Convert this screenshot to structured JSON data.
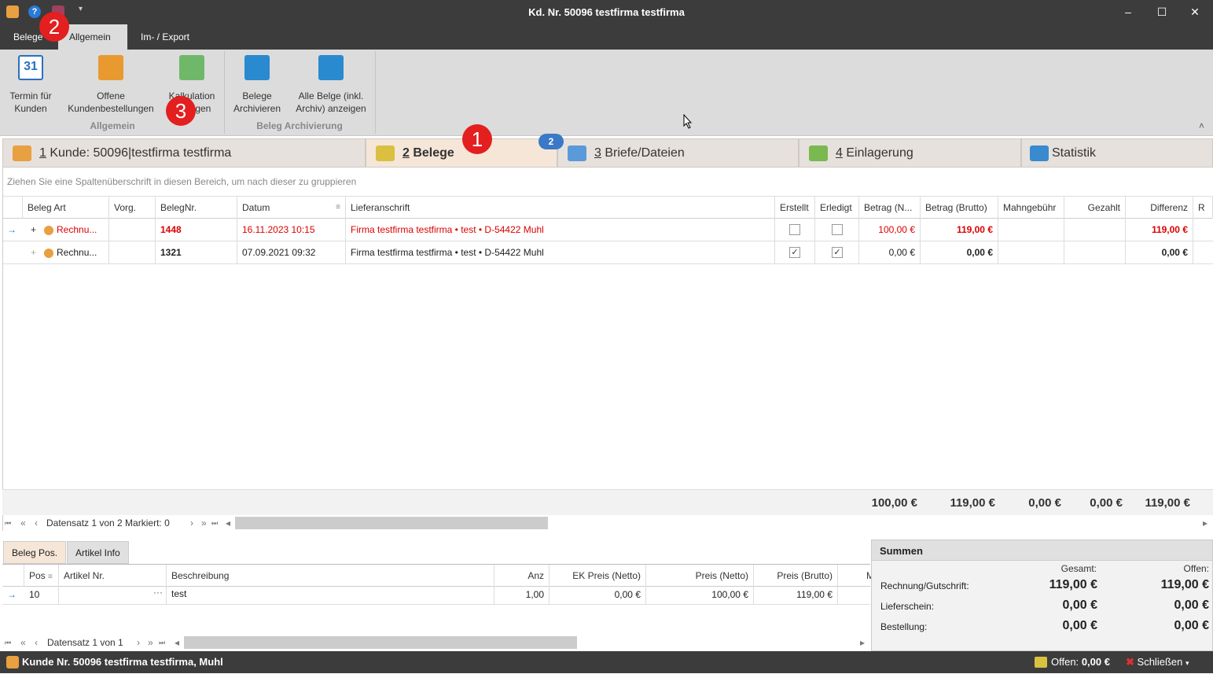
{
  "window": {
    "title": "Kd. Nr. 50096 testfirma testfirma",
    "min": "–",
    "max": "☐",
    "close": "✕",
    "qa_more": "▾"
  },
  "menu_tabs": [
    "Belege",
    "Allgemein",
    "Im- / Export"
  ],
  "ribbon": {
    "groups": [
      {
        "label": "Allgemein"
      },
      {
        "label": "Beleg Archivierung"
      }
    ],
    "buttons": [
      {
        "l1": "Termin für",
        "l2": "Kunden",
        "icon": "calendar-icon",
        "icon_text": "31"
      },
      {
        "l1": "Offene",
        "l2": "Kundenbestellungen",
        "icon": "shopping-cart-icon"
      },
      {
        "l1": "Kalkulation",
        "l2": "anzeigen",
        "icon": "calculation-icon"
      },
      {
        "l1": "Belege",
        "l2": "Archivieren",
        "icon": "archive-icon"
      },
      {
        "l1": "Alle Belge (inkl.",
        "l2": "Archiv) anzeigen",
        "icon": "archive-show-icon"
      }
    ],
    "collapse": "˄"
  },
  "annotations": [
    "1",
    "2",
    "3"
  ],
  "page_tabs": [
    {
      "num": "1",
      "label": " Kunde: 50096|testfirma testfirma"
    },
    {
      "num": "2",
      "label": " Belege"
    },
    {
      "num": "3",
      "label": " Briefe/Dateien"
    },
    {
      "num": "4",
      "label": " Einlagerung"
    },
    {
      "num": "",
      "label": "Statistik"
    }
  ],
  "tab_badge": "2",
  "group_hint": "Ziehen Sie eine Spaltenüberschrift in diesen Bereich, um nach dieser zu gruppieren",
  "columns": [
    "Beleg Art",
    "Vorg.",
    "BelegNr.",
    "Datum",
    "Lieferanschrift",
    "Erstellt",
    "Erledigt",
    "Betrag (N...",
    "Betrag (Brutto)",
    "Mahngebühr",
    "Gezahlt",
    "Differenz",
    "R"
  ],
  "rows": [
    {
      "indicator": "→",
      "expand": "+",
      "art": "Rechnu...",
      "vorg": "",
      "nr": "1448",
      "datum": "16.11.2023 10:15",
      "adresse": "Firma testfirma testfirma • test • D-54422 Muhl",
      "erstellt": "",
      "erledigt": "",
      "netto": "100,00 €",
      "brutto": "119,00 €",
      "mahn": "",
      "gezahlt": "",
      "diff": "119,00 €"
    },
    {
      "indicator": "",
      "expand": "+",
      "art": "Rechnu...",
      "vorg": "",
      "nr": "1321",
      "datum": "07.09.2021 09:32",
      "adresse": "Firma testfirma testfirma • test • D-54422 Muhl",
      "erstellt": "✓",
      "erledigt": "✓",
      "netto": "0,00 €",
      "brutto": "0,00 €",
      "mahn": "",
      "gezahlt": "",
      "diff": "0,00 €"
    }
  ],
  "totals": {
    "netto": "100,00 €",
    "brutto": "119,00 €",
    "mahn": "0,00 €",
    "gezahlt": "0,00 €",
    "diff": "119,00 €"
  },
  "nav_main": {
    "first": "⏮",
    "prev_page": "«",
    "prev": "‹",
    "text": "Datensatz 1 von 2 Markiert: 0",
    "next": "›",
    "next_page": "»",
    "last": "⏭",
    "sl": "◂",
    "sr": "▸"
  },
  "sub_tabs": [
    "Beleg Pos.",
    "Artikel Info"
  ],
  "pos_columns": [
    "Pos",
    "Artikel Nr.",
    "Beschreibung",
    "Anz",
    "EK Preis (Netto)",
    "Preis (Netto)",
    "Preis (Brutto)",
    "M"
  ],
  "pos_sort": "≡",
  "pos_rows": [
    {
      "indicator": "→",
      "pos": "10",
      "artikel": "",
      "ellipsis": "···",
      "beschreibung": "test",
      "anz": "1,00",
      "ek": "0,00 €",
      "netto": "100,00 €",
      "brutto": "119,00 €"
    }
  ],
  "nav_pos": {
    "text": "Datensatz 1 von 1"
  },
  "summen": {
    "title": "Summen",
    "h_gesamt": "Gesamt:",
    "h_offen": "Offen:",
    "rows": [
      {
        "label": "Rechnung/Gutschrift:",
        "gesamt": "119,00 €",
        "offen": "119,00 €"
      },
      {
        "label": "Lieferschein:",
        "gesamt": "0,00 €",
        "offen": "0,00 €"
      },
      {
        "label": "Bestellung:",
        "gesamt": "0,00 €",
        "offen": "0,00 €"
      }
    ]
  },
  "status": {
    "customer": "Kunde Nr. 50096 testfirma testfirma, Muhl",
    "offen_label": "Offen:",
    "offen_value": "0,00 €",
    "close": "Schließen",
    "close_arrow": "▾",
    "close_icon": "✖"
  },
  "colors": {
    "titlebar": "#3c3c3c",
    "ribbon": "#dcdcdc",
    "active_tab": "#f5e6d8",
    "red_text": "#dd0000",
    "badge_red": "#e31f1f",
    "badge_blue": "#3a78c8"
  }
}
